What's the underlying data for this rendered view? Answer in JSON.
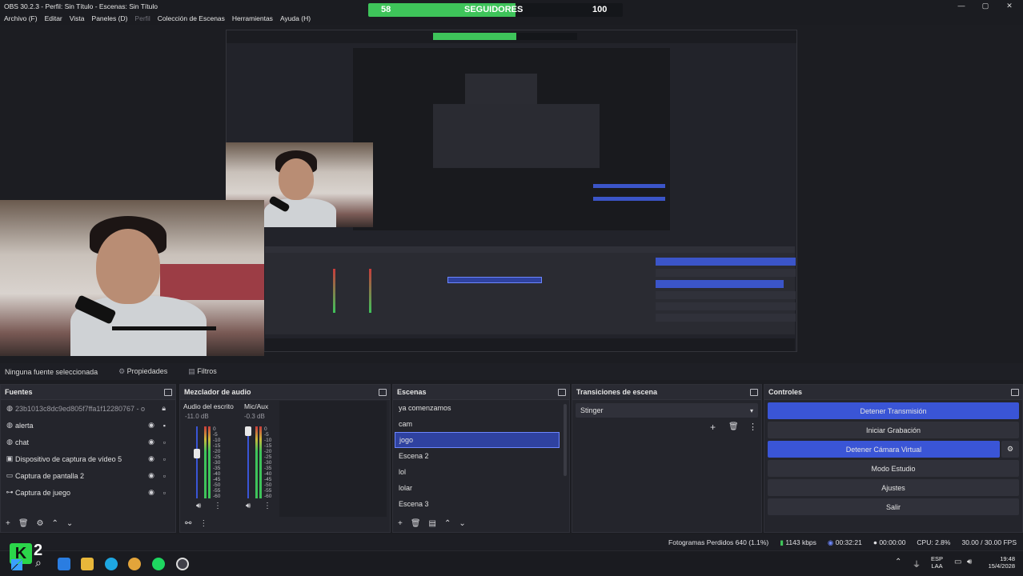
{
  "window": {
    "title": "OBS 30.2.3 - Perfil: Sin Título - Escenas: Sin Título",
    "controls": [
      "—",
      "▢",
      "✕"
    ]
  },
  "menu": [
    "Archivo (F)",
    "Editar",
    "Vista",
    "Paneles (D)",
    "Perfil",
    "Colección de Escenas",
    "Herramientas",
    "Ayuda (H)"
  ],
  "followers": {
    "current": "58",
    "label": "SEGUIDORES",
    "goal": "100",
    "progress": 0.58,
    "color": "#3ec45a"
  },
  "source_bar": {
    "status": "Ninguna fuente seleccionada",
    "properties": "Propiedades",
    "filters": "Filtros"
  },
  "sources": {
    "title": "Fuentes",
    "items": [
      {
        "label": "23b1013c8dc9ed805f7ffa1f12280767 - o",
        "icon": "globe-icon"
      },
      {
        "label": "alerta",
        "icon": "globe-icon"
      },
      {
        "label": "chat",
        "icon": "globe-icon"
      },
      {
        "label": "Dispositivo de captura de vídeo 5",
        "icon": "camera-icon"
      },
      {
        "label": "Captura de pantalla 2",
        "icon": "monitor-icon"
      },
      {
        "label": "Captura de juego",
        "icon": "gamepad-icon"
      }
    ]
  },
  "mixer": {
    "title": "Mezclador de audio",
    "channels": [
      {
        "name": "Audio del escrito",
        "db": "-11.0 dB",
        "level": 0.55
      },
      {
        "name": "Mic/Aux",
        "db": "-0.3 dB",
        "level": 0.8
      }
    ],
    "scale": [
      "0",
      "-5",
      "-10",
      "-15",
      "-20",
      "-25",
      "-30",
      "-35",
      "-40",
      "-45",
      "-50",
      "-55",
      "-60"
    ]
  },
  "scenes": {
    "title": "Escenas",
    "items": [
      "ya comenzamos",
      "cam",
      "jogo",
      "Escena 2",
      "lol",
      "lolar",
      "Escena 3"
    ],
    "selected": "jogo"
  },
  "transitions": {
    "title": "Transiciones de escena",
    "selected": "Stinger"
  },
  "controls": {
    "title": "Controles",
    "buttons": [
      "Detener Transmisión",
      "Iniciar Grabación",
      "Detener Cámara Virtual",
      "Modo Estudio",
      "Ajustes",
      "Salir"
    ]
  },
  "status": {
    "dropped": "Fotogramas Perdidos 640 (1.1%)",
    "bitrate": "1143 kbps",
    "stream_time": "00:32:21",
    "rec_time": "00:00:00",
    "cpu": "CPU: 2.8%",
    "fps": "30.00 / 30.00 FPS"
  },
  "taskbar": {
    "lang": "ESP",
    "lang2": "LAA",
    "time": "19:48",
    "date": "15/4/2028",
    "badge": "2"
  },
  "colors": {
    "accent": "#3a55d6",
    "green": "#3ec45a"
  }
}
